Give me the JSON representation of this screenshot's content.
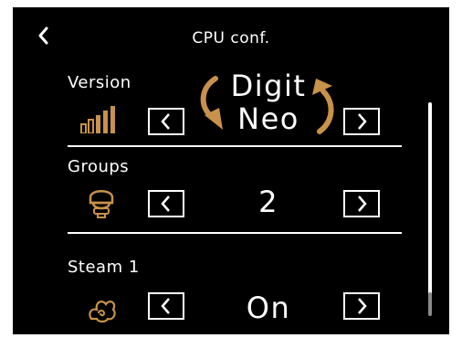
{
  "header": {
    "title": "CPU conf.",
    "back_icon": "chevron-left-icon"
  },
  "settings": [
    {
      "label": "Version",
      "icon": "signal-bars-icon",
      "value_line1": "Digit",
      "value_line2": "Neo"
    },
    {
      "label": "Groups",
      "icon": "group-head-icon",
      "value": "2"
    },
    {
      "label": "Steam 1",
      "icon": "steam-icon",
      "value": "On"
    }
  ],
  "colors": {
    "background": "#000000",
    "text": "#ffffff",
    "accent": "#c8924a",
    "scrollbar_thumb": "#8a8a8a"
  }
}
